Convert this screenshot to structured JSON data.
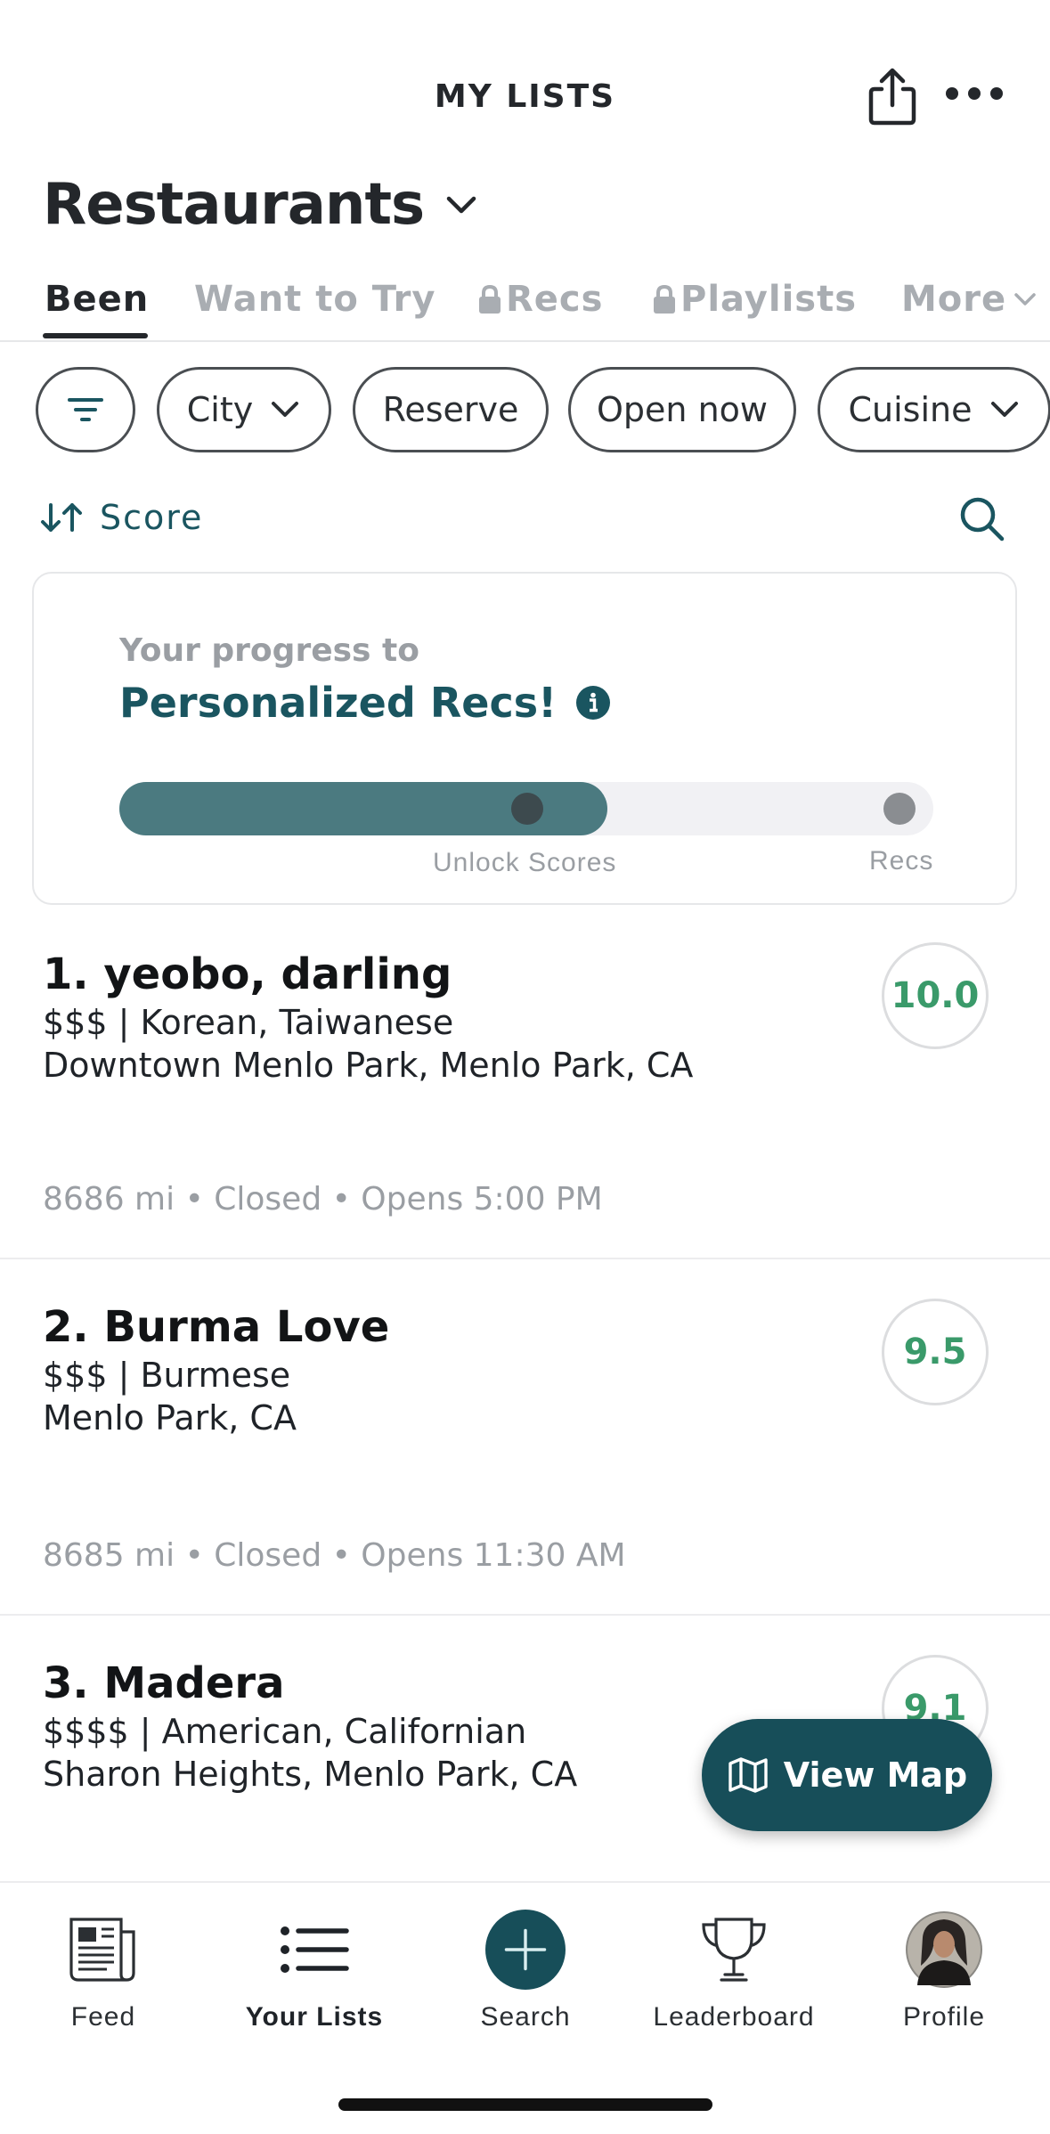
{
  "header": {
    "title": "MY LISTS"
  },
  "list": {
    "title": "Restaurants"
  },
  "tabs": [
    {
      "label": "Been",
      "locked": false,
      "active": true
    },
    {
      "label": "Want to Try",
      "locked": false,
      "active": false
    },
    {
      "label": "Recs",
      "locked": true,
      "active": false
    },
    {
      "label": "Playlists",
      "locked": true,
      "active": false
    },
    {
      "label": "More",
      "locked": false,
      "active": false
    }
  ],
  "filters": {
    "city": "City",
    "reserve": "Reserve",
    "open_now": "Open now",
    "cuisine": "Cuisine"
  },
  "sort": {
    "label": "Score"
  },
  "progress": {
    "subtitle": "Your progress to",
    "title": "Personalized Recs!",
    "fill_fraction": 0.6,
    "milestone_1": "Unlock Scores",
    "milestone_2": "Recs"
  },
  "restaurants": [
    {
      "name": "1. yeobo, darling",
      "line1": "$$$ | Korean, Taiwanese",
      "line2": "Downtown Menlo Park, Menlo Park, CA",
      "meta": "8686 mi • Closed • Opens 5:00 PM",
      "score": "10.0"
    },
    {
      "name": "2. Burma Love",
      "line1": "$$$ | Burmese",
      "line2": "Menlo Park, CA",
      "meta": "8685 mi • Closed • Opens 11:30 AM",
      "score": "9.5"
    },
    {
      "name": "3. Madera",
      "line1": "$$$$ | American, Californian",
      "line2": "Sharon Heights, Menlo Park, CA",
      "score": "9.1"
    }
  ],
  "view_map": {
    "label": "View Map"
  },
  "nav": [
    {
      "label": "Feed",
      "icon": "newspaper-icon"
    },
    {
      "label": "Your Lists",
      "icon": "list-icon",
      "active": true
    },
    {
      "label": "Search",
      "icon": "plus-icon"
    },
    {
      "label": "Leaderboard",
      "icon": "trophy-icon"
    },
    {
      "label": "Profile",
      "icon": "avatar"
    }
  ],
  "colors": {
    "brand": "#174e59",
    "score_green": "#3a9a6a",
    "progress_fill": "#4b7a80"
  }
}
